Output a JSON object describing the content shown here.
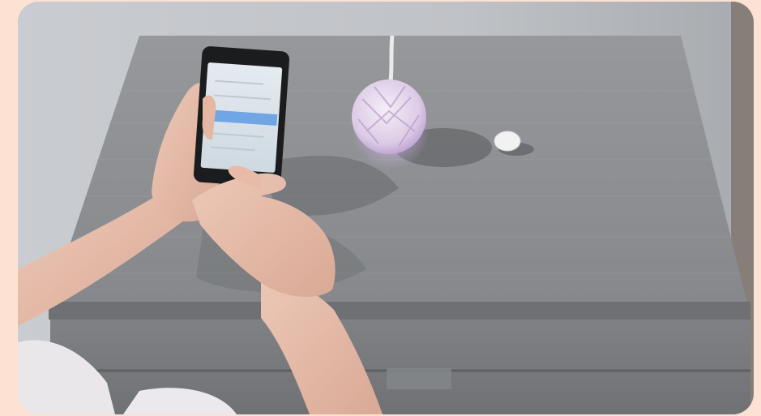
{
  "page": {
    "background_color": "#fde2d3"
  },
  "photo": {
    "subject": "person-using-smartphone-near-smart-diffuser",
    "colors": {
      "wall": "#c3c6ca",
      "tabletop": "#8d8f92",
      "drawer_front": "#7b7d80",
      "skin": "#e6bba8",
      "phone_body": "#1b1c1e",
      "phone_screen": "#d9e2ea",
      "screen_highlight": "#5e9be3",
      "diffuser": "#e8dcec",
      "diffuser_glow": "#c8a6e0",
      "sensor": "#eeeeee"
    }
  }
}
